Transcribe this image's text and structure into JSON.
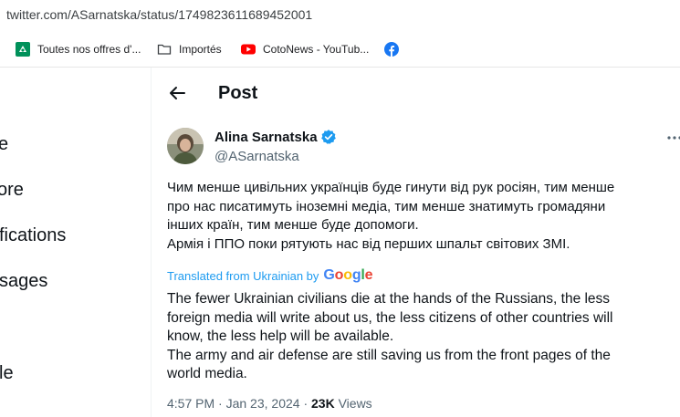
{
  "browser": {
    "url": "twitter.com/ASarnatska/status/1749823611689452001",
    "bookmarks": [
      {
        "label": "Toutes nos offres d'...",
        "icon": "bank-logo-icon"
      },
      {
        "label": "Importés",
        "icon": "folder-icon"
      },
      {
        "label": "CotoNews - YouTub...",
        "icon": "youtube-icon"
      },
      {
        "label": "",
        "icon": "facebook-icon"
      }
    ]
  },
  "sidebar": {
    "items": [
      {
        "label": "e"
      },
      {
        "label": "ore"
      },
      {
        "label": "fications"
      },
      {
        "label": "sages"
      },
      {
        "label": "le"
      }
    ]
  },
  "header": {
    "title": "Post"
  },
  "tweet": {
    "author_name": "Alina Sarnatska",
    "author_handle": "@ASarnatska",
    "original_lines": [
      "Чим менше цивільних українців буде гинути від рук росіян, тим менше",
      "про нас писатимуть іноземні медіа, тим менше знатимуть громадяни",
      "інших країн, тим менше буде допомоги.",
      "Армія і ППО поки рятують нас від перших шпальт світових ЗМІ."
    ],
    "translated_label": "Translated from Ukrainian by",
    "translator": "Google",
    "translation_lines": [
      "The fewer Ukrainian civilians die at the hands of the Russians, the less",
      "foreign media will write about us, the less citizens of other countries will",
      "know, the less help will be available.",
      "The army and air defense are still saving us from the front pages of the",
      "world media."
    ],
    "time": "4:57 PM",
    "date": "Jan 23, 2024",
    "separator": "·",
    "views_count": "23K",
    "views_label": "Views"
  },
  "colors": {
    "accent": "#1d9bf0",
    "secondary_text": "#536471",
    "primary_text": "#0f1419"
  }
}
